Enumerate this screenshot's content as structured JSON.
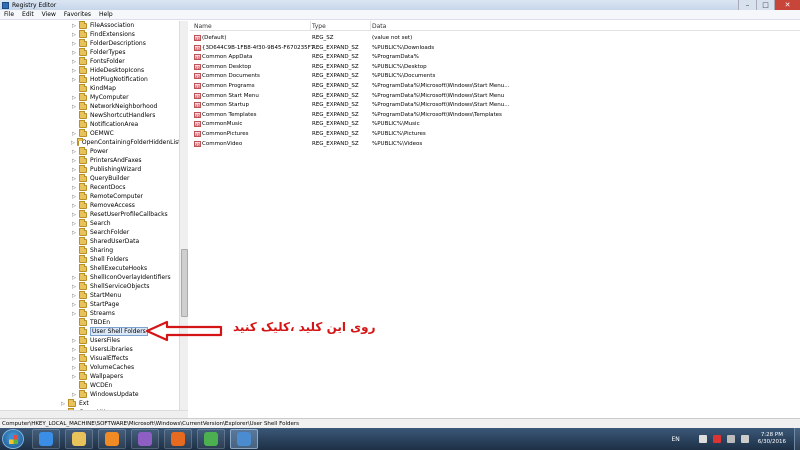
{
  "window": {
    "title": "Registry Editor"
  },
  "menu": [
    "File",
    "Edit",
    "View",
    "Favorites",
    "Help"
  ],
  "tree": {
    "items": [
      {
        "label": "FileAssociation",
        "expandable": true
      },
      {
        "label": "FindExtensions",
        "expandable": true
      },
      {
        "label": "FolderDescriptions",
        "expandable": true
      },
      {
        "label": "FolderTypes",
        "expandable": true
      },
      {
        "label": "FontsFolder",
        "expandable": true
      },
      {
        "label": "HideDesktopIcons",
        "expandable": true
      },
      {
        "label": "HotPlugNotification",
        "expandable": true
      },
      {
        "label": "KindMap",
        "expandable": false
      },
      {
        "label": "MyComputer",
        "expandable": true
      },
      {
        "label": "NetworkNeighborhood",
        "expandable": true
      },
      {
        "label": "NewShortcutHandlers",
        "expandable": false
      },
      {
        "label": "NotificationArea",
        "expandable": false
      },
      {
        "label": "OEMWC",
        "expandable": true
      },
      {
        "label": "OpenContainingFolderHiddenList",
        "expandable": true
      },
      {
        "label": "Power",
        "expandable": true
      },
      {
        "label": "PrintersAndFaxes",
        "expandable": true
      },
      {
        "label": "PublishingWizard",
        "expandable": true
      },
      {
        "label": "QueryBuilder",
        "expandable": true
      },
      {
        "label": "RecentDocs",
        "expandable": true
      },
      {
        "label": "RemoteComputer",
        "expandable": true
      },
      {
        "label": "RemoveAccess",
        "expandable": true
      },
      {
        "label": "ResetUserProfileCallbacks",
        "expandable": true
      },
      {
        "label": "Search",
        "expandable": true
      },
      {
        "label": "SearchFolder",
        "expandable": true
      },
      {
        "label": "SharedUserData",
        "expandable": false
      },
      {
        "label": "Sharing",
        "expandable": false
      },
      {
        "label": "Shell Folders",
        "expandable": false
      },
      {
        "label": "ShellExecuteHooks",
        "expandable": false
      },
      {
        "label": "ShellIconOverlayIdentifiers",
        "expandable": true
      },
      {
        "label": "ShellServiceObjects",
        "expandable": true
      },
      {
        "label": "StartMenu",
        "expandable": true
      },
      {
        "label": "StartPage",
        "expandable": true
      },
      {
        "label": "Streams",
        "expandable": true
      },
      {
        "label": "TBDEn",
        "expandable": false
      },
      {
        "label": "User Shell Folders",
        "expandable": false,
        "selected": true
      },
      {
        "label": "UsersFiles",
        "expandable": true
      },
      {
        "label": "UsersLibraries",
        "expandable": true
      },
      {
        "label": "VisualEffects",
        "expandable": true
      },
      {
        "label": "VolumeCaches",
        "expandable": true
      },
      {
        "label": "Wallpapers",
        "expandable": true
      },
      {
        "label": "WCDEn",
        "expandable": false
      },
      {
        "label": "WindowsUpdate",
        "expandable": true
      },
      {
        "label": "Ext",
        "expandable": true,
        "level": "up"
      },
      {
        "label": "GameUX",
        "expandable": true,
        "level": "up"
      }
    ]
  },
  "list": {
    "columns": [
      "Name",
      "Type",
      "Data"
    ],
    "rows": [
      {
        "name": "(Default)",
        "type": "REG_SZ",
        "data": "(value not set)"
      },
      {
        "name": "{3D644C9B-1FB8-4f30-9B45-F670235F7...",
        "type": "REG_EXPAND_SZ",
        "data": "%PUBLIC%\\Downloads"
      },
      {
        "name": "Common AppData",
        "type": "REG_EXPAND_SZ",
        "data": "%ProgramData%"
      },
      {
        "name": "Common Desktop",
        "type": "REG_EXPAND_SZ",
        "data": "%PUBLIC%\\Desktop"
      },
      {
        "name": "Common Documents",
        "type": "REG_EXPAND_SZ",
        "data": "%PUBLIC%\\Documents"
      },
      {
        "name": "Common Programs",
        "type": "REG_EXPAND_SZ",
        "data": "%ProgramData%\\Microsoft\\Windows\\Start Menu..."
      },
      {
        "name": "Common Start Menu",
        "type": "REG_EXPAND_SZ",
        "data": "%ProgramData%\\Microsoft\\Windows\\Start Menu"
      },
      {
        "name": "Common Startup",
        "type": "REG_EXPAND_SZ",
        "data": "%ProgramData%\\Microsoft\\Windows\\Start Menu..."
      },
      {
        "name": "Common Templates",
        "type": "REG_EXPAND_SZ",
        "data": "%ProgramData%\\Microsoft\\Windows\\Templates"
      },
      {
        "name": "CommonMusic",
        "type": "REG_EXPAND_SZ",
        "data": "%PUBLIC%\\Music"
      },
      {
        "name": "CommonPictures",
        "type": "REG_EXPAND_SZ",
        "data": "%PUBLIC%\\Pictures"
      },
      {
        "name": "CommonVideo",
        "type": "REG_EXPAND_SZ",
        "data": "%PUBLIC%\\Videos"
      }
    ]
  },
  "annotation": {
    "text": "روی این کلید ،کلیک کنید",
    "color": "#d51515"
  },
  "statusbar": {
    "path": "Computer\\HKEY_LOCAL_MACHINE\\SOFTWARE\\Microsoft\\Windows\\CurrentVersion\\Explorer\\User Shell Folders"
  },
  "taskbar": {
    "apps": [
      {
        "icon": "ie-icon",
        "color": "#3a8ee6"
      },
      {
        "icon": "explorer-icon",
        "color": "#e8c25a"
      },
      {
        "icon": "media-player-icon",
        "color": "#f08a24"
      },
      {
        "icon": "visual-studio-icon",
        "color": "#8e5fc2"
      },
      {
        "icon": "firefox-icon",
        "color": "#e66a1f"
      },
      {
        "icon": "chrome-icon",
        "color": "#4caf50"
      },
      {
        "icon": "regedit-icon",
        "color": "#4a8ccf"
      }
    ],
    "lang": "EN",
    "time": "7:28 PM",
    "date": "6/30/2016"
  }
}
